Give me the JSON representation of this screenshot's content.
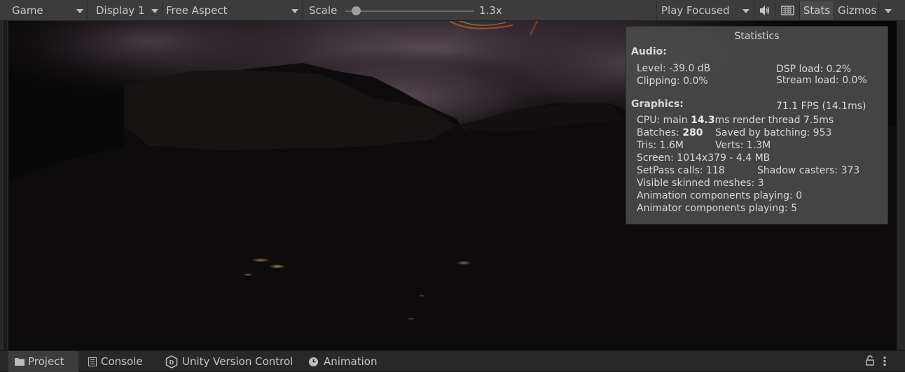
{
  "toolbar": {
    "view_dropdown": "Game",
    "display_dropdown": "Display 1",
    "aspect_dropdown": "Free Aspect",
    "scale_label": "Scale",
    "scale_value": "1.3x",
    "scale_level": 0.05,
    "play_mode_dropdown": "Play Focused",
    "stats_button": "Stats",
    "gizmos_button": "Gizmos"
  },
  "stats": {
    "title": "Statistics",
    "audio_heading": "Audio:",
    "level": "Level: -39.0 dB",
    "dsp_load": "DSP load: 0.2%",
    "clipping": "Clipping: 0.0%",
    "stream_load": "Stream load: 0.0%",
    "graphics_heading": "Graphics:",
    "fps": "71.1 FPS (14.1ms)",
    "cpu_prefix": "CPU: main ",
    "cpu_main": "14.3",
    "cpu_suffix": "ms  render thread 7.5ms",
    "batches_prefix": "Batches: ",
    "batches_value": "280",
    "saved_by_batching": "Saved by batching: 953",
    "tris": "Tris: 1.6M",
    "verts": "Verts: 1.3M",
    "screen": "Screen: 1014x379 - 4.4 MB",
    "setpass_calls": "SetPass calls: 118",
    "shadow_casters": "Shadow casters: 373",
    "visible_skinned_meshes": "Visible skinned meshes: 3",
    "animation_components": "Animation components playing: 0",
    "animator_components": "Animator components playing: 5"
  },
  "bottom_tabs": [
    {
      "label": "Project",
      "icon": "folder-icon"
    },
    {
      "label": "Console",
      "icon": "console-icon"
    },
    {
      "label": "Unity Version Control",
      "icon": "version-control-icon"
    },
    {
      "label": "Animation",
      "icon": "clock-icon"
    }
  ]
}
